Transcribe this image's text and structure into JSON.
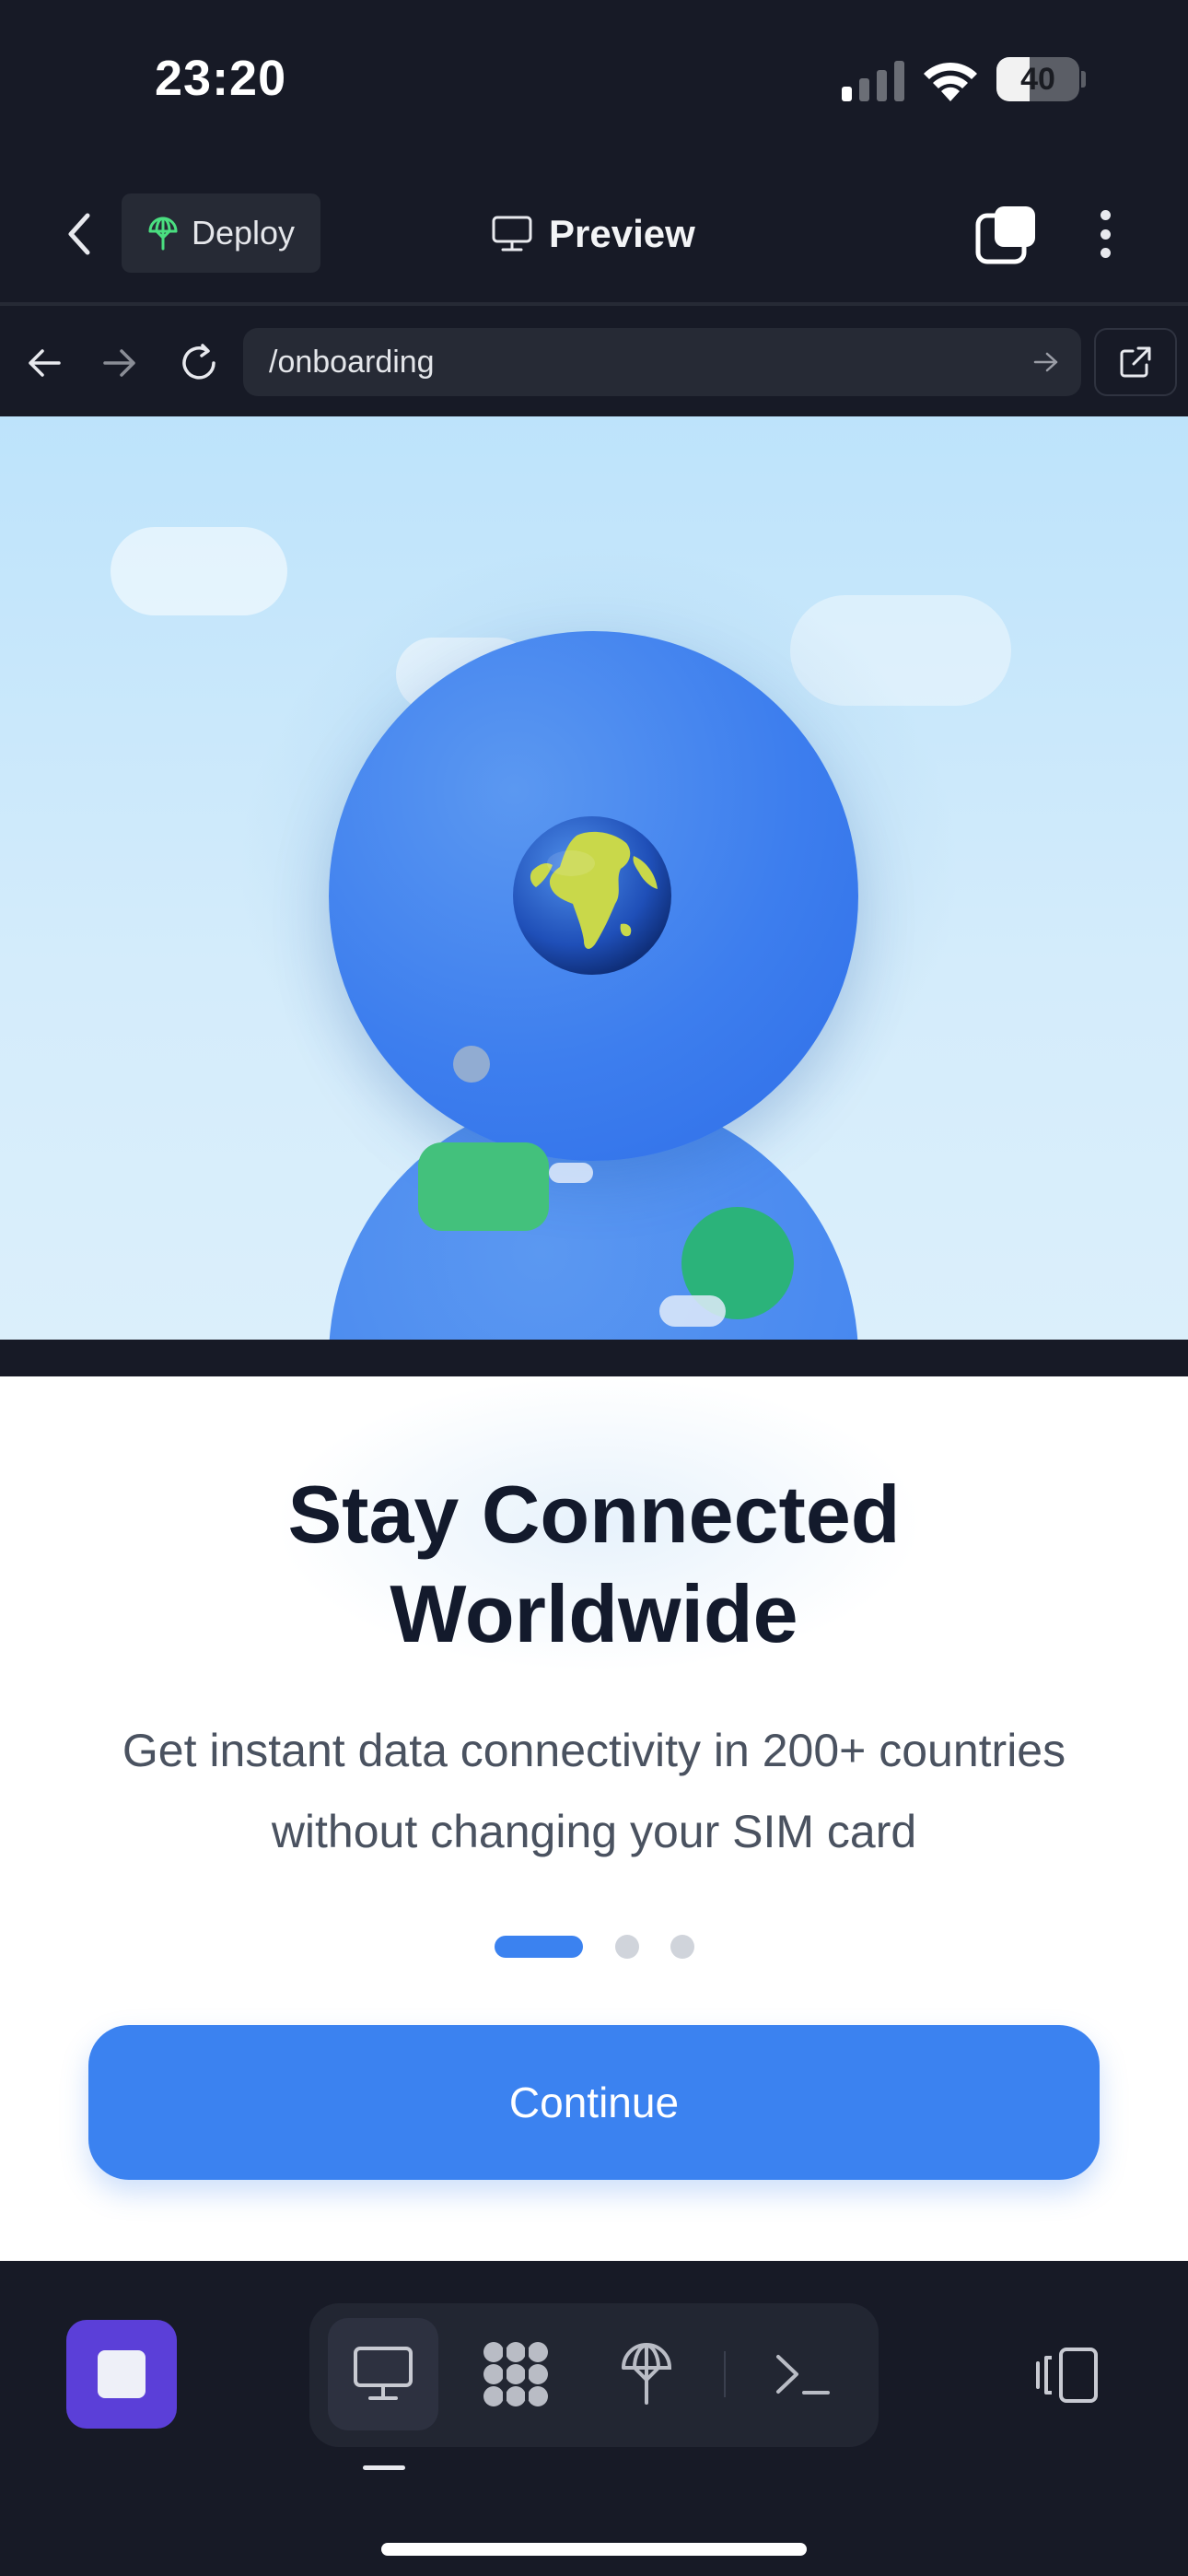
{
  "status_bar": {
    "time": "23:20",
    "battery_level": "40",
    "battery_fraction": 0.4
  },
  "header": {
    "deploy_label": "Deploy",
    "title": "Preview"
  },
  "browser": {
    "url": "/onboarding"
  },
  "onboarding": {
    "headline": "Stay Connected Worldwide",
    "description": "Get instant data connectivity in 200+ countries without changing your SIM card",
    "page_count": 3,
    "current_page": 1,
    "continue_label": "Continue"
  },
  "icons": {
    "globe": "🌍"
  },
  "colors": {
    "accent": "#3b82f0",
    "stop_button": "#5b3fd8",
    "deploy_icon": "#4ade80",
    "background": "#171a26"
  }
}
